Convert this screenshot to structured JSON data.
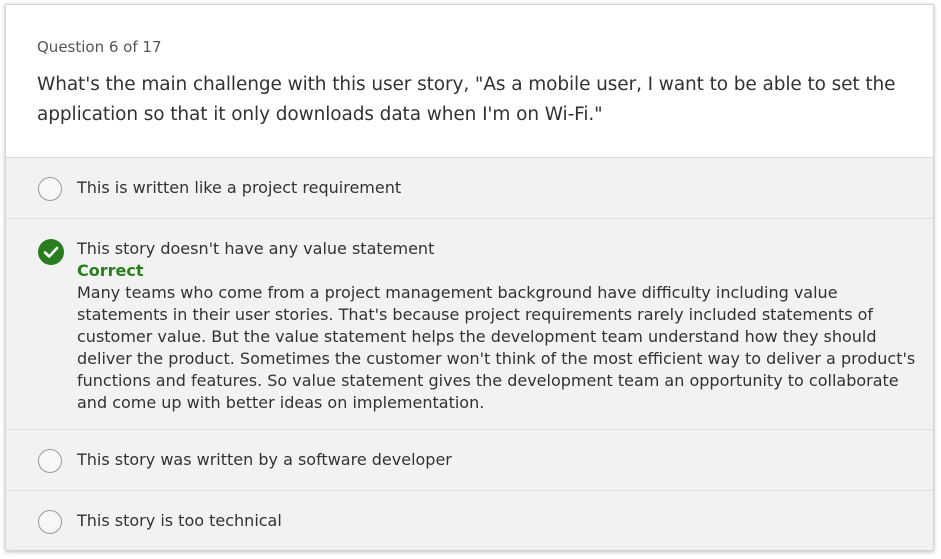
{
  "question": {
    "counter": "Question 6 of 17",
    "text": "What's the main challenge with this user story, \"As a mobile user, I want to be able to set the application so that it only downloads data when I'm on Wi-Fi.\""
  },
  "options": [
    {
      "label": "This is written like a project requirement",
      "state": "unselected"
    },
    {
      "label": "This story doesn't have any value statement",
      "state": "correct",
      "result_label": "Correct",
      "explanation": "Many teams who come from a project management background have difficulty including value statements in their user stories. That's because project requirements rarely included statements of customer value. But the value statement helps the development team understand how they should deliver the product. Sometimes the customer won't think of the most efficient way to deliver a product's functions and features. So value statement gives the development team an opportunity to collaborate and come up with better ideas on implementation."
    },
    {
      "label": "This story was written by a software developer",
      "state": "unselected"
    },
    {
      "label": "This story is too technical",
      "state": "unselected"
    }
  ],
  "colors": {
    "correct": "#2a7d1e",
    "option_bg": "#f2f2f2",
    "text": "#323232"
  },
  "icons": {
    "radio": "radio-empty-icon",
    "correct": "checkmark-circle-icon"
  }
}
